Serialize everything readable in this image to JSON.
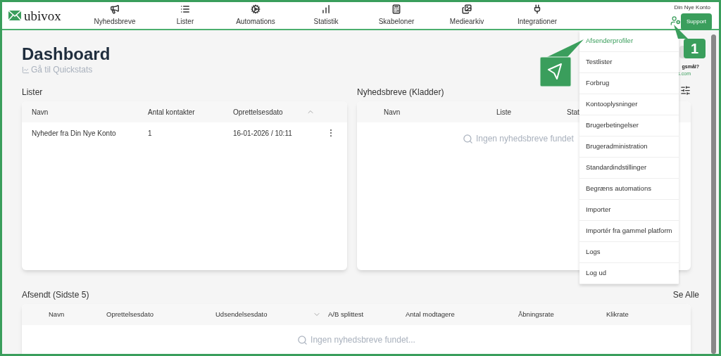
{
  "header": {
    "logo": "ubivox",
    "account": "Din Nye Konto",
    "support_button": "Support",
    "nav": [
      {
        "label": "Nyhedsbreve"
      },
      {
        "label": "Lister"
      },
      {
        "label": "Automations"
      },
      {
        "label": "Statistik"
      },
      {
        "label": "Skabeloner"
      },
      {
        "label": "Mediearkiv"
      },
      {
        "label": "Integrationer"
      }
    ]
  },
  "page": {
    "title": "Dashboard",
    "quickstats_link": "Gå til Quickstats",
    "help_text": "gsmål?",
    "help_link": "s.com"
  },
  "lists_panel": {
    "title": "Lister",
    "columns": [
      "Navn",
      "Antal kontakter",
      "Oprettelsesdato"
    ],
    "rows": [
      [
        "Nyheder fra Din Nye Konto",
        "1",
        "16-01-2026 / 10:11"
      ]
    ]
  },
  "drafts_panel": {
    "title": "Nyhedsbreve (Kladder)",
    "columns": [
      "Navn",
      "Liste",
      "Stat"
    ],
    "empty_text": "Ingen nyhedsbreve fundet"
  },
  "sent_panel": {
    "title": "Afsendt (Sidste 5)",
    "see_all": "Se Alle",
    "columns": [
      "Navn",
      "Oprettelsesdato",
      "Udsendelsesdato",
      "A/B splittest",
      "Antal modtagere",
      "Åbningsrate",
      "Klikrate"
    ],
    "empty_text": "Ingen nyhedsbreve fundet..."
  },
  "account_menu": {
    "items": [
      {
        "label": "Afsenderprofiler",
        "selected": true
      },
      {
        "label": "Testlister",
        "selected": false
      },
      {
        "label": "Forbrug",
        "selected": false
      },
      {
        "label": "Kontooplysninger",
        "selected": false
      },
      {
        "label": "Brugerbetingelser",
        "selected": false
      },
      {
        "label": "Brugeradministration",
        "selected": false
      },
      {
        "label": "Standardindstillinger",
        "selected": false
      },
      {
        "label": "Begræns automations",
        "selected": false
      },
      {
        "label": "Importer",
        "selected": false
      },
      {
        "label": "Importér fra gammel platform",
        "selected": false
      },
      {
        "label": "Logs",
        "selected": false
      },
      {
        "label": "Log ud",
        "selected": false
      }
    ]
  },
  "callouts": [
    {
      "kind": "icon"
    },
    {
      "kind": "number",
      "text": "1"
    }
  ]
}
